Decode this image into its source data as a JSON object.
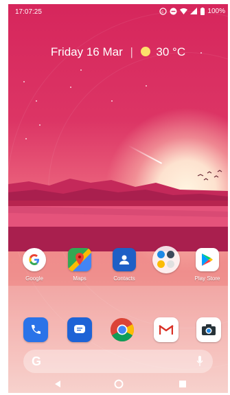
{
  "status_bar": {
    "time": "17:07:25",
    "battery": "100%",
    "icons": [
      "sync-icon",
      "do-not-disturb-icon",
      "wifi-icon",
      "signal-icon",
      "battery-icon"
    ]
  },
  "glance": {
    "date": "Friday 16 Mar",
    "separator": "|",
    "temperature": "30 °C",
    "weather_icon": "sun-cloud-icon"
  },
  "apps": [
    {
      "label": "Google",
      "icon": "google-icon"
    },
    {
      "label": "Maps",
      "icon": "maps-icon"
    },
    {
      "label": "Contacts",
      "icon": "contacts-icon"
    },
    {
      "label": "",
      "icon": "folder-icon"
    },
    {
      "label": "Play Store",
      "icon": "play-store-icon"
    }
  ],
  "dock": [
    {
      "icon": "phone-icon"
    },
    {
      "icon": "messages-icon"
    },
    {
      "icon": "chrome-icon"
    },
    {
      "icon": "gmail-icon"
    },
    {
      "icon": "camera-icon"
    }
  ],
  "search_bar": {
    "logo": "G",
    "icon": "microphone-icon"
  },
  "nav_bar": {
    "buttons": [
      "back-icon",
      "home-icon",
      "recents-icon"
    ]
  },
  "colors": {
    "sky": "#d6265c",
    "horizon": "#f08a8a",
    "sun": "#fff4e0"
  }
}
